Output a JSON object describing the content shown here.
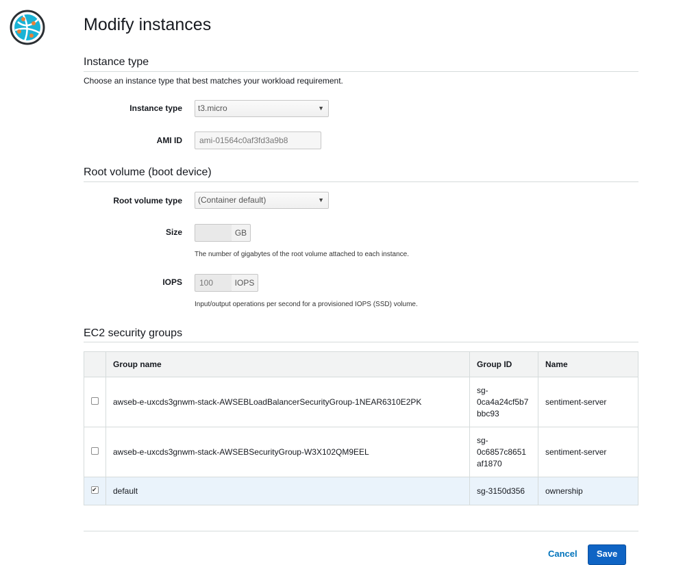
{
  "page": {
    "title": "Modify instances"
  },
  "instance_type_section": {
    "title": "Instance type",
    "description": "Choose an instance type that best matches your workload requirement.",
    "instance_type_label": "Instance type",
    "instance_type_value": "t3.micro",
    "ami_id_label": "AMI ID",
    "ami_id_value": "ami-01564c0af3fd3a9b8"
  },
  "root_volume_section": {
    "title": "Root volume (boot device)",
    "type_label": "Root volume type",
    "type_value": "(Container default)",
    "size_label": "Size",
    "size_value": "",
    "size_unit": "GB",
    "size_hint": "The number of gigabytes of the root volume attached to each instance.",
    "iops_label": "IOPS",
    "iops_value": "100",
    "iops_unit": "IOPS",
    "iops_hint": "Input/output operations per second for a provisioned IOPS (SSD) volume."
  },
  "security_groups_section": {
    "title": "EC2 security groups",
    "columns": [
      "Group name",
      "Group ID",
      "Name"
    ],
    "rows": [
      {
        "checked": false,
        "group_name": "awseb-e-uxcds3gnwm-stack-AWSEBLoadBalancerSecurityGroup-1NEAR6310E2PK",
        "group_id_lines": [
          "sg-",
          "0ca4a24cf5b7",
          "bbc93"
        ],
        "name": "sentiment-server"
      },
      {
        "checked": false,
        "group_name": "awseb-e-uxcds3gnwm-stack-AWSEBSecurityGroup-W3X102QM9EEL",
        "group_id_lines": [
          "sg-",
          "0c6857c8651",
          "af1870"
        ],
        "name": "sentiment-server"
      },
      {
        "checked": true,
        "group_name": "default",
        "group_id_lines": [
          "sg-3150d356"
        ],
        "name": "ownership"
      }
    ]
  },
  "actions": {
    "cancel_label": "Cancel",
    "save_label": "Save"
  },
  "colors": {
    "accent": "#0f64c4",
    "link": "#0073bb",
    "selected_row": "#eaf3fb",
    "header_bg": "#f2f3f3"
  }
}
